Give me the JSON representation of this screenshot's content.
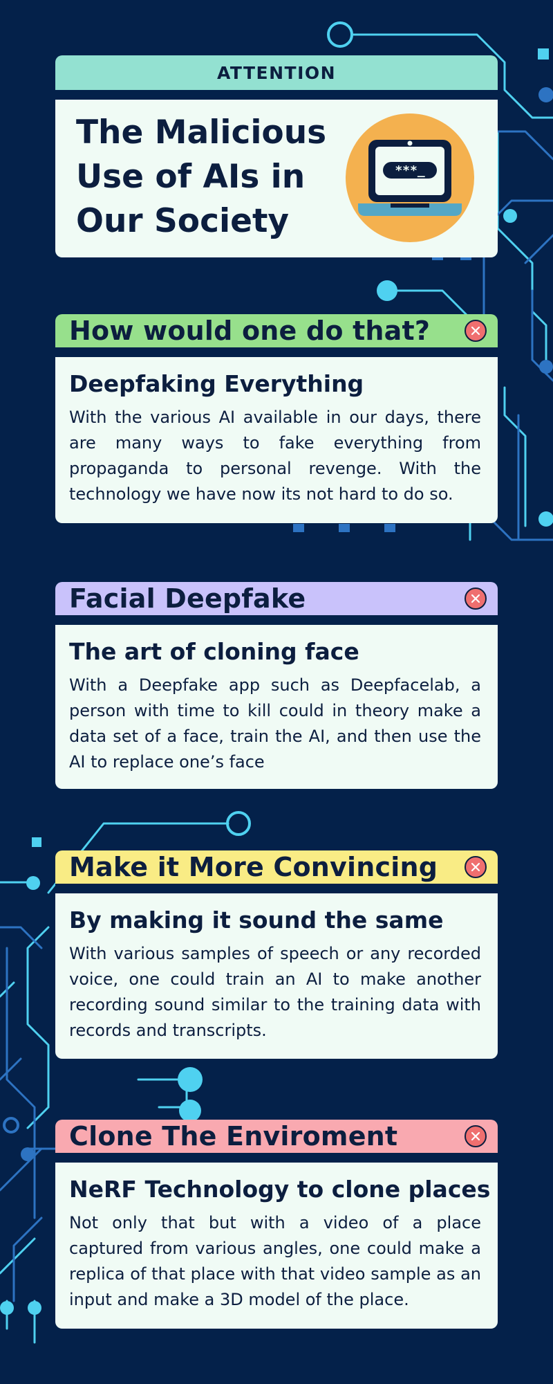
{
  "hero": {
    "label": "ATTENTION",
    "title": "The Malicious Use of AIs in Our Society",
    "password_glyphs": "***_"
  },
  "sections": [
    {
      "bar_title": "How would one do that?",
      "bar_color": "#97e08c",
      "heading": "Deepfaking Everything",
      "body": "With the various AI available in our days, there are many ways to fake everything from propaganda to personal revenge. With the technology we have now its not hard to do so."
    },
    {
      "bar_title": "Facial Deepfake",
      "bar_color": "#c9c2fb",
      "heading": "The art of cloning face",
      "body": "With a Deepfake app such as Deepfacelab, a person with time to kill could in theory make a data set of a face, train the AI, and then use the AI to replace one’s face"
    },
    {
      "bar_title": "Make it More Convincing",
      "bar_color": "#f9ec85",
      "heading": "By making it sound the same",
      "body": "With various samples of speech or any recorded voice, one could train an AI to make another recording sound similar to the training data with records and transcripts."
    },
    {
      "bar_title": "Clone The Enviroment",
      "bar_color": "#f9a9b0",
      "heading": "NeRF Technology to clone places",
      "body": "Not only that but with a video of a place captured from various angles, one could make a replica of that place with that video sample as an input and make a 3D model of the place."
    }
  ],
  "colors": {
    "background": "#04214a",
    "card_body": "#f0fbf5",
    "text": "#0c1e3f",
    "circuit_light": "#4fd1f0",
    "circuit_dark": "#2d73c2",
    "close_button": "#ef6f6f",
    "laptop_circle": "#f4b14f"
  },
  "icons": [
    "circuit-decoration",
    "laptop-password-icon",
    "close-icon"
  ]
}
